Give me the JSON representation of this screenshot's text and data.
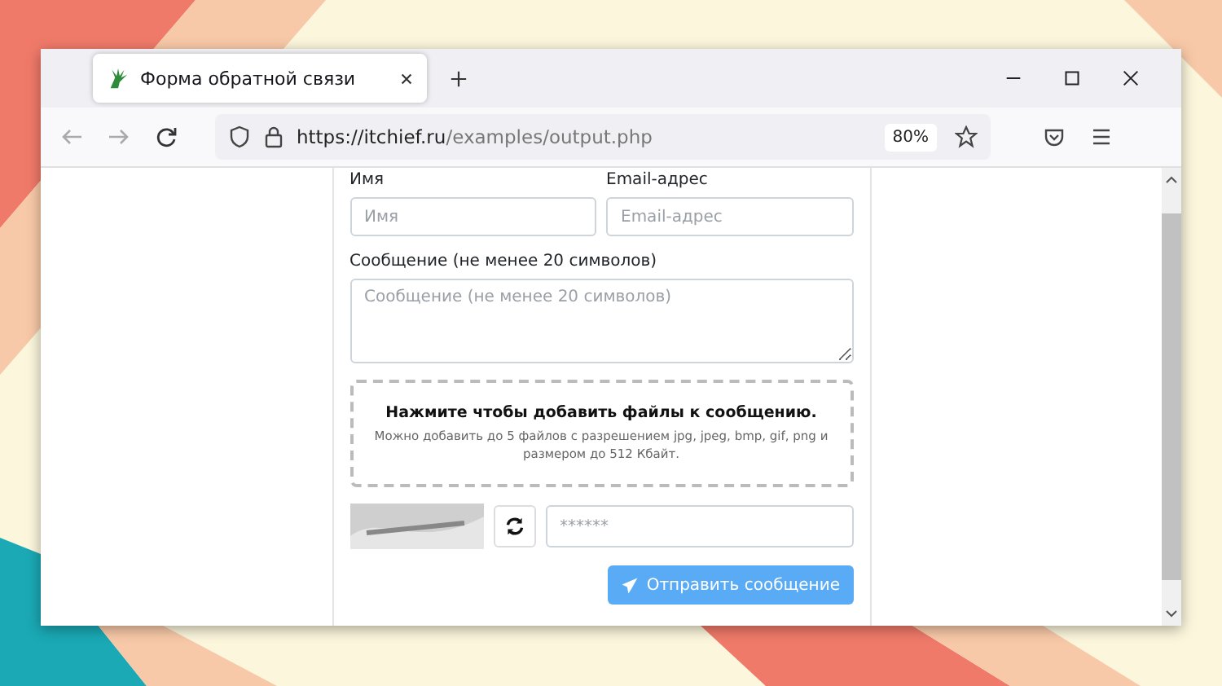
{
  "tab": {
    "title": "Форма обратной связи",
    "selected": true
  },
  "address_bar": {
    "url_host": "https://itchief.ru",
    "url_path": "/examples/output.php",
    "zoom": "80%"
  },
  "form": {
    "name_label": "Имя",
    "name_placeholder": "Имя",
    "email_label": "Email-адрес",
    "email_placeholder": "Email-адрес",
    "message_label": "Сообщение (не менее 20 символов)",
    "message_placeholder": "Сообщение (не менее 20 символов)",
    "dropzone_title": "Нажмите чтобы добавить файлы к сообщению.",
    "dropzone_hint": "Можно добавить до 5 файлов с разрешением jpg, jpeg, bmp, gif, png и размером до 512 Кбайт.",
    "captcha_placeholder": "******",
    "submit": "Отправить сообщение"
  }
}
